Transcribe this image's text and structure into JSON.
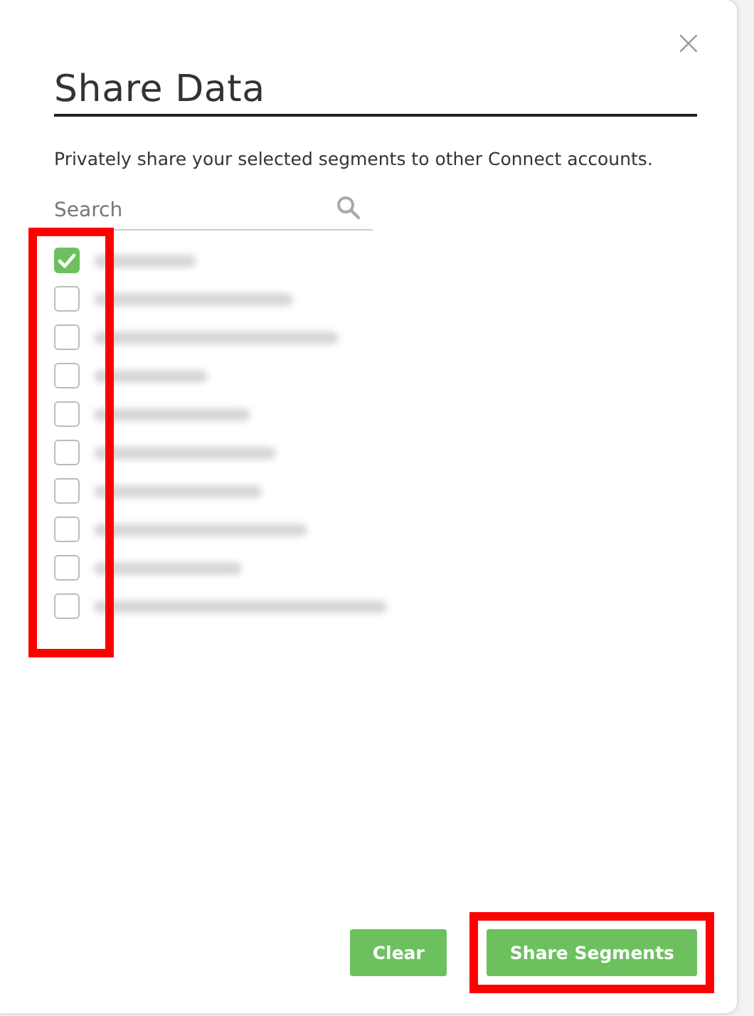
{
  "dialog": {
    "title": "Share Data",
    "close": "×",
    "description": "Privately share your selected segments to other Connect accounts."
  },
  "search": {
    "placeholder": "Search"
  },
  "segments": [
    {
      "checked": true
    },
    {
      "checked": false
    },
    {
      "checked": false
    },
    {
      "checked": false
    },
    {
      "checked": false
    },
    {
      "checked": false
    },
    {
      "checked": false
    },
    {
      "checked": false
    },
    {
      "checked": false
    },
    {
      "checked": false
    }
  ],
  "buttons": [
    {
      "label": "Clear",
      "highlighted": false
    },
    {
      "label": "Share Segments",
      "highlighted": true
    }
  ],
  "highlights": {
    "segment_checkboxes": true
  }
}
